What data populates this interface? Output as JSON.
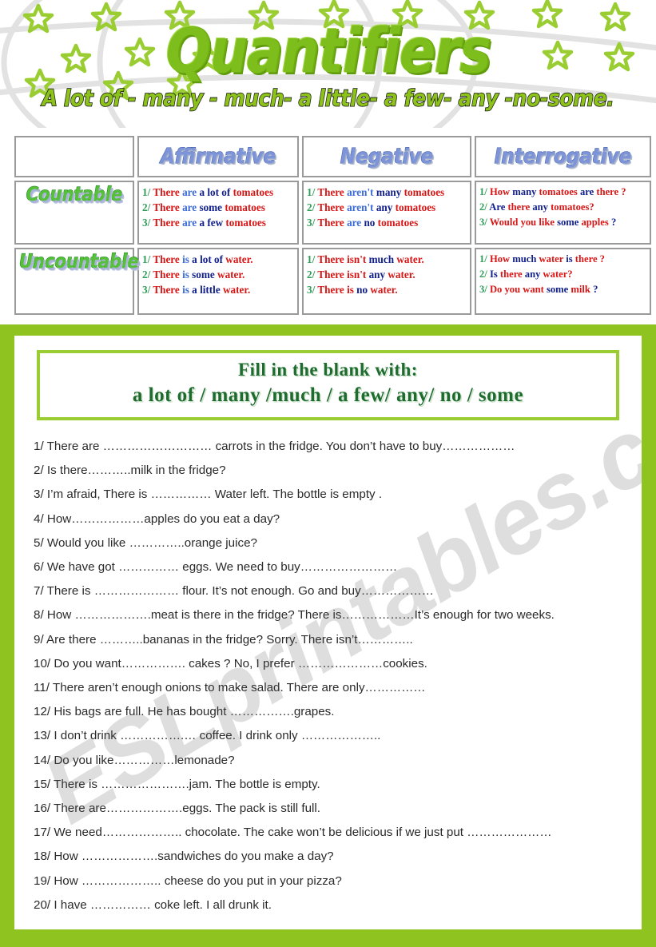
{
  "header": {
    "title": "Quantifiers",
    "subtitle": "A lot of - many - much- a little- a few- any -no-some."
  },
  "table": {
    "columns": [
      "",
      "Affirmative",
      "Negative",
      "Interrogative"
    ],
    "rows": [
      {
        "label": "Countable",
        "affirmative": [
          {
            "num": "1/",
            "parts": [
              {
                "t": "There",
                "c": "red"
              },
              {
                "t": "are",
                "c": "blue"
              },
              {
                "t": "a lot of",
                "c": "navy"
              },
              {
                "t": "tomatoes",
                "c": "red"
              }
            ]
          },
          {
            "num": "2/",
            "parts": [
              {
                "t": "There",
                "c": "red"
              },
              {
                "t": "are",
                "c": "blue"
              },
              {
                "t": "some",
                "c": "navy"
              },
              {
                "t": "tomatoes",
                "c": "red"
              }
            ]
          },
          {
            "num": "3/",
            "parts": [
              {
                "t": "There",
                "c": "red"
              },
              {
                "t": "are",
                "c": "blue"
              },
              {
                "t": "a few",
                "c": "navy"
              },
              {
                "t": "tomatoes",
                "c": "red"
              }
            ]
          }
        ],
        "negative": [
          {
            "num": "1/",
            "parts": [
              {
                "t": "There",
                "c": "red"
              },
              {
                "t": "aren't",
                "c": "blue"
              },
              {
                "t": "many",
                "c": "navy"
              },
              {
                "t": "tomatoes",
                "c": "red"
              }
            ]
          },
          {
            "num": "2/",
            "parts": [
              {
                "t": "There",
                "c": "red"
              },
              {
                "t": "aren't",
                "c": "blue"
              },
              {
                "t": "any",
                "c": "navy"
              },
              {
                "t": "tomatoes",
                "c": "red"
              }
            ]
          },
          {
            "num": "3/",
            "parts": [
              {
                "t": "There",
                "c": "red"
              },
              {
                "t": "are",
                "c": "blue"
              },
              {
                "t": "no",
                "c": "navy"
              },
              {
                "t": "tomatoes",
                "c": "red"
              }
            ]
          }
        ],
        "interrogative": [
          {
            "num": "1/",
            "parts": [
              {
                "t": "How",
                "c": "red"
              },
              {
                "t": "many",
                "c": "navy"
              },
              {
                "t": "tomatoes",
                "c": "red"
              },
              {
                "t": "are",
                "c": "navy"
              },
              {
                "t": "there ?",
                "c": "red"
              }
            ]
          },
          {
            "num": "2/",
            "parts": [
              {
                "t": "Are",
                "c": "navy"
              },
              {
                "t": "there",
                "c": "red"
              },
              {
                "t": "any",
                "c": "navy"
              },
              {
                "t": "tomatoes?",
                "c": "red"
              }
            ]
          },
          {
            "num": "3/",
            "parts": [
              {
                "t": "Would you like",
                "c": "red"
              },
              {
                "t": "some",
                "c": "navy"
              },
              {
                "t": "apples",
                "c": "red"
              },
              {
                "t": "?",
                "c": "navy"
              }
            ]
          }
        ]
      },
      {
        "label": "Uncountable",
        "affirmative": [
          {
            "num": "1/",
            "parts": [
              {
                "t": "There",
                "c": "red"
              },
              {
                "t": "is",
                "c": "blue"
              },
              {
                "t": "a lot of",
                "c": "navy"
              },
              {
                "t": "water.",
                "c": "red"
              }
            ]
          },
          {
            "num": "2/",
            "parts": [
              {
                "t": "There",
                "c": "red"
              },
              {
                "t": "is",
                "c": "blue"
              },
              {
                "t": "some",
                "c": "navy"
              },
              {
                "t": "water.",
                "c": "red"
              }
            ]
          },
          {
            "num": "3/",
            "parts": [
              {
                "t": "There",
                "c": "red"
              },
              {
                "t": "is",
                "c": "blue"
              },
              {
                "t": "a little",
                "c": "navy"
              },
              {
                "t": "water.",
                "c": "red"
              }
            ]
          }
        ],
        "negative": [
          {
            "num": "1/",
            "parts": [
              {
                "t": "There",
                "c": "red"
              },
              {
                "t": "isn't",
                "c": "red"
              },
              {
                "t": "much",
                "c": "navy"
              },
              {
                "t": "water.",
                "c": "red"
              }
            ]
          },
          {
            "num": "2/",
            "parts": [
              {
                "t": "There",
                "c": "red"
              },
              {
                "t": "isn't",
                "c": "red"
              },
              {
                "t": "any",
                "c": "navy"
              },
              {
                "t": "water.",
                "c": "red"
              }
            ]
          },
          {
            "num": "3/",
            "parts": [
              {
                "t": "There",
                "c": "red"
              },
              {
                "t": "is",
                "c": "red"
              },
              {
                "t": "no",
                "c": "navy"
              },
              {
                "t": "water.",
                "c": "red"
              }
            ]
          }
        ],
        "interrogative": [
          {
            "num": "1/",
            "parts": [
              {
                "t": "How",
                "c": "red"
              },
              {
                "t": "much",
                "c": "navy"
              },
              {
                "t": "water",
                "c": "red"
              },
              {
                "t": "is",
                "c": "navy"
              },
              {
                "t": "there ?",
                "c": "red"
              }
            ]
          },
          {
            "num": "2/",
            "parts": [
              {
                "t": "Is",
                "c": "navy"
              },
              {
                "t": "there",
                "c": "red"
              },
              {
                "t": "any",
                "c": "navy"
              },
              {
                "t": "water?",
                "c": "red"
              }
            ]
          },
          {
            "num": "3/",
            "parts": [
              {
                "t": "Do you want",
                "c": "red"
              },
              {
                "t": "some",
                "c": "navy"
              },
              {
                "t": "milk",
                "c": "red"
              },
              {
                "t": "?",
                "c": "navy"
              }
            ]
          }
        ]
      }
    ]
  },
  "exercise": {
    "instruction_line1": "Fill in the blank with:",
    "instruction_line2": "a lot of / many /much / a few/ any/ no / some",
    "questions": [
      "1/ There are ……………………… carrots in the fridge. You don’t have to buy………………",
      "2/ Is there………..milk in the fridge?",
      "3/ I’m afraid, There is …………… Water left. The bottle is empty .",
      "4/ How………………apples do you eat a day?",
      "5/ Would you like …………..orange juice?",
      "6/ We have got …………… eggs. We need to buy……………………",
      "7/ There is ………………… flour. It’s not enough. Go and buy………………",
      "8/ How ……………….meat is there in the fridge? There is………………It’s enough for two weeks.",
      "9/ Are there ………..bananas in the fridge? Sorry. There isn’t…………..",
      "10/ Do you want……………. cakes ? No, I prefer …………………cookies.",
      "11/ There aren’t enough onions to make salad. There are only……………",
      "12/  His bags are full. He has bought …………….grapes.",
      "13/ I don’t drink …………….… coffee. I drink only ………………..",
      "14/ Do you like……………lemonade?",
      "15/ There is ………………….jam. The bottle is empty.",
      "16/ There are……………….eggs. The pack is still full.",
      "17/ We need……………….. chocolate. The cake won’t be delicious if we just put …………………",
      "18/ How ……………….sandwiches do you make a day?",
      "19/ How ……………….. cheese do you put in your pizza?",
      "20/ I have …………… coke left. I all drunk it."
    ]
  },
  "watermark": {
    "text": "ESLprintables.com"
  },
  "colors": {
    "brand_green": "#8FC31F",
    "title_green": "#7DBE1C",
    "instruction_green": "#1E6B2E",
    "instruction_border": "#9ACD32",
    "star_green": "#9ACD32",
    "red": "#D81616",
    "blue": "#3A6BD8",
    "navy": "#12208C",
    "num_green": "#2E9B57",
    "table_border": "#9a9a9a",
    "wordart_blue": "#7D94D8"
  }
}
